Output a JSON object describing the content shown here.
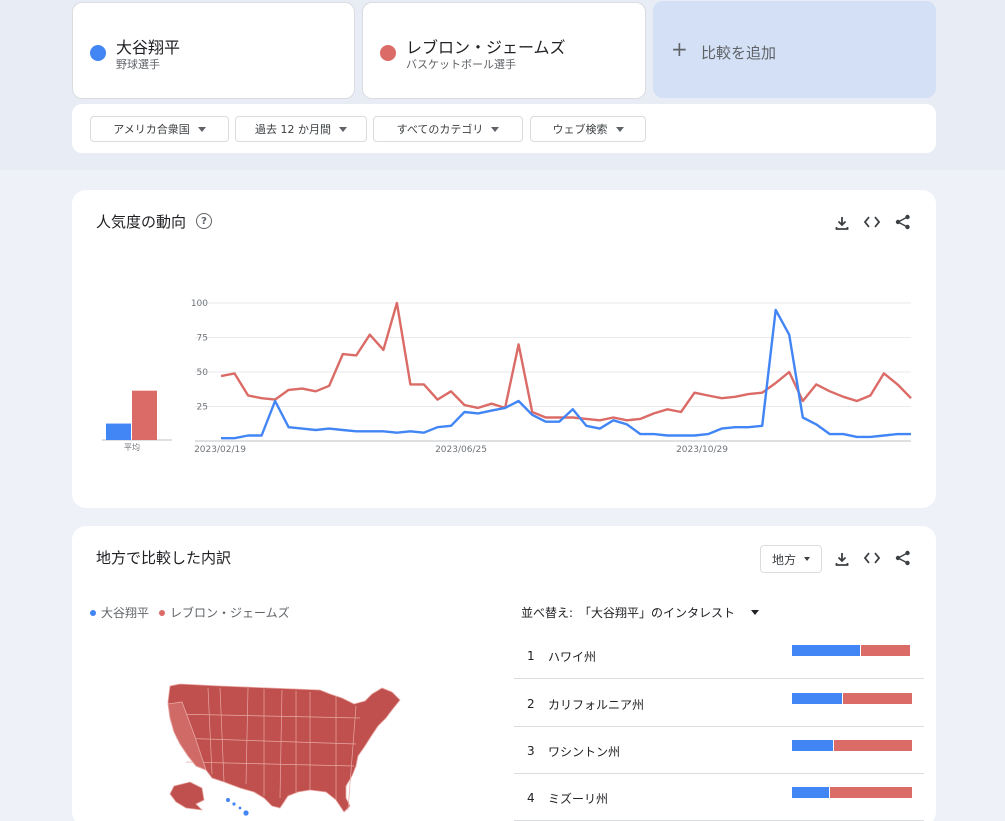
{
  "terms": [
    {
      "name": "大谷翔平",
      "sub": "野球選手",
      "color": "#4285f4"
    },
    {
      "name": "レブロン・ジェームズ",
      "sub": "バスケットボール選手",
      "color": "#db6b66"
    }
  ],
  "add_compare": {
    "label": "比較を追加"
  },
  "filters": [
    "アメリカ合衆国",
    "過去 12 か月間",
    "すべてのカテゴリ",
    "ウェブ検索"
  ],
  "interest_over_time": {
    "title": "人気度の動向",
    "help": "?"
  },
  "chart_data": {
    "type": "line",
    "title": "",
    "x_ticks": [
      "2023/02/19",
      "2023/06/25",
      "2023/10/29"
    ],
    "y_ticks": [
      25,
      50,
      75,
      100
    ],
    "ylim": [
      0,
      100
    ],
    "grid": true,
    "average_label": "平均",
    "averages": [
      {
        "series": "大谷翔平",
        "value": 12
      },
      {
        "series": "レブロン・ジェームズ",
        "value": 36
      }
    ],
    "series": [
      {
        "name": "大谷翔平",
        "color": "#4285f4",
        "values": [
          2,
          2,
          4,
          4,
          29,
          10,
          9,
          8,
          9,
          8,
          7,
          7,
          7,
          6,
          7,
          6,
          10,
          11,
          21,
          20,
          22,
          24,
          29,
          19,
          14,
          14,
          23,
          11,
          9,
          15,
          12,
          5,
          5,
          4,
          4,
          4,
          5,
          9,
          10,
          10,
          11,
          95,
          77,
          17,
          12,
          5,
          5,
          3,
          3,
          4,
          5,
          5
        ]
      },
      {
        "name": "レブロン・ジェームズ",
        "color": "#db6b66",
        "values": [
          47,
          49,
          33,
          31,
          30,
          37,
          38,
          36,
          40,
          63,
          62,
          77,
          66,
          100,
          41,
          41,
          30,
          36,
          26,
          24,
          27,
          24,
          70,
          21,
          17,
          17,
          17,
          16,
          15,
          17,
          15,
          16,
          20,
          23,
          21,
          35,
          33,
          31,
          32,
          34,
          35,
          42,
          50,
          29,
          41,
          36,
          32,
          29,
          33,
          49,
          41,
          31
        ]
      }
    ]
  },
  "regional": {
    "title": "地方で比較した内訳",
    "region_select": "地方",
    "legend": [
      "大谷翔平",
      "レブロン・ジェームズ"
    ],
    "sort_prefix": "並べ替え:",
    "sort_value": "「大谷翔平」のインタレスト",
    "rows": [
      {
        "rank": "1",
        "name": "ハワイ州",
        "share_a": 58
      },
      {
        "rank": "2",
        "name": "カリフォルニア州",
        "share_a": 42
      },
      {
        "rank": "3",
        "name": "ワシントン州",
        "share_a": 35
      },
      {
        "rank": "4",
        "name": "ミズーリ州",
        "share_a": 31
      }
    ]
  },
  "icons": [
    "download-icon",
    "embed-icon",
    "share-icon",
    "help-icon",
    "plus-icon"
  ],
  "colors": {
    "ohtani": "#4285f4",
    "lebron": "#db6b66",
    "map_fill": "#c0504d"
  }
}
